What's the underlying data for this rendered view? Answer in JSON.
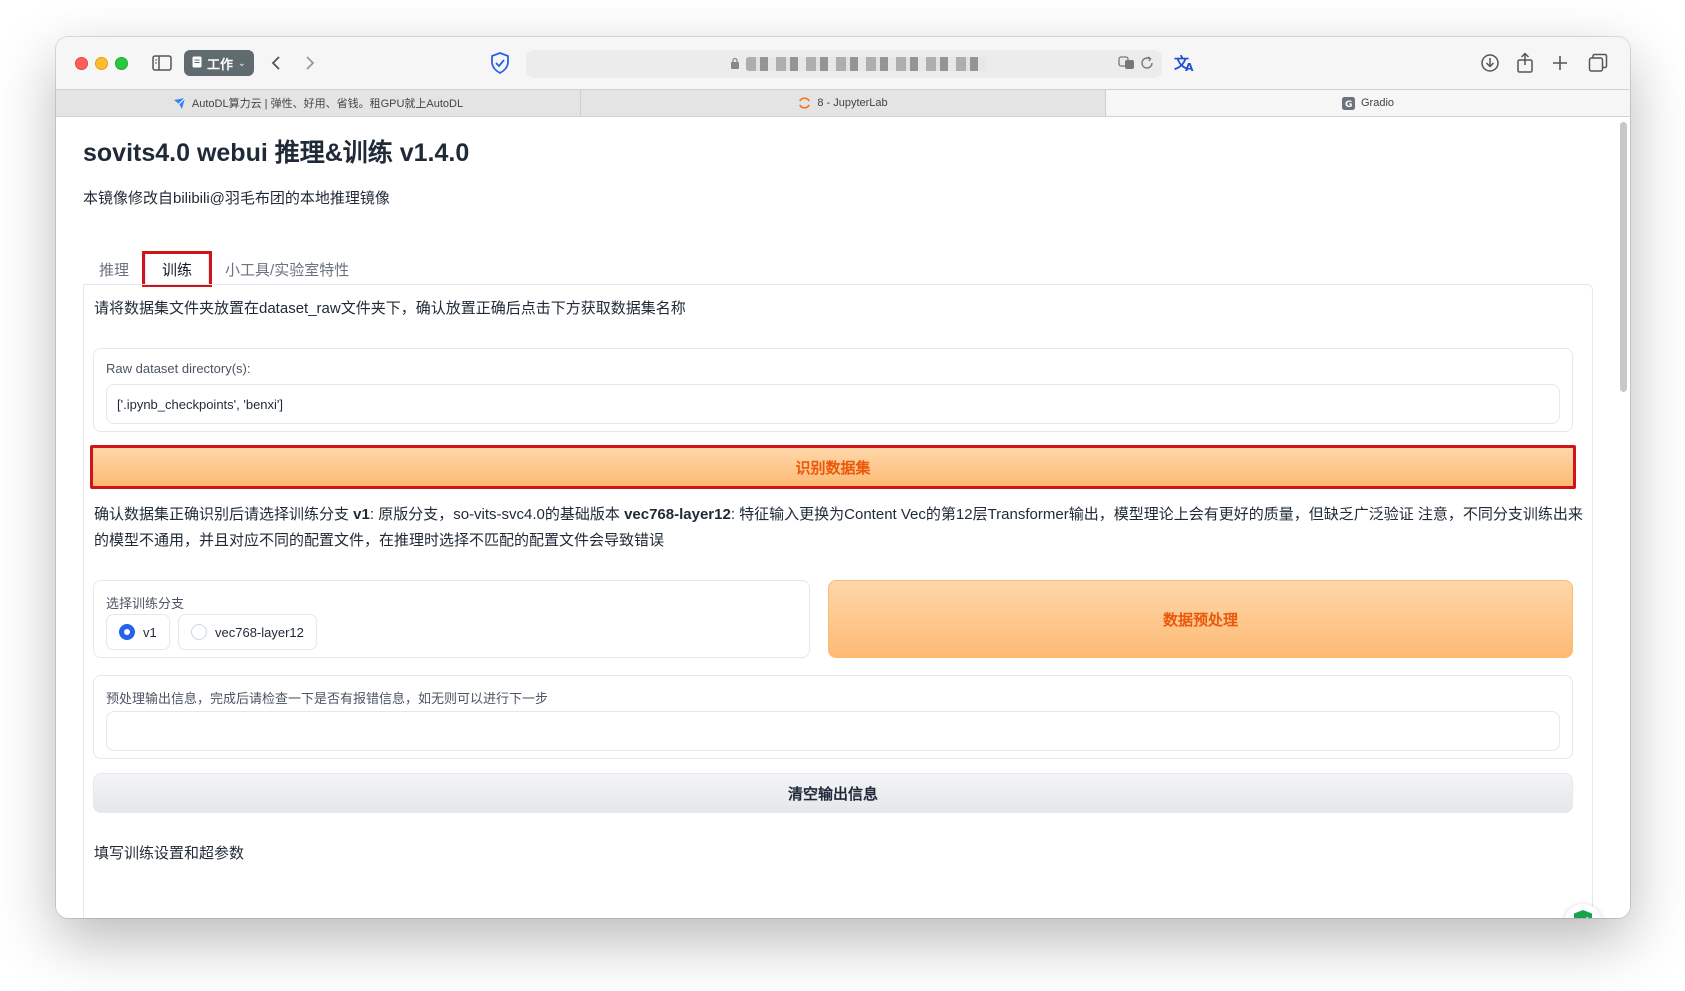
{
  "browser": {
    "workspace_label": "工作",
    "tabs": [
      {
        "label": "AutoDL算力云 | 弹性、好用、省钱。租GPU就上AutoDL",
        "icon": "autodl-icon"
      },
      {
        "label": "8 - JupyterLab",
        "icon": "jupyter-loading-icon"
      },
      {
        "label": "Gradio",
        "icon": "gradio-icon"
      }
    ]
  },
  "page": {
    "title": "sovits4.0 webui 推理&训练 v1.4.0",
    "subtitle": "本镜像修改自bilibili@羽毛布团的本地推理镜像",
    "tabs": [
      "推理",
      "训练",
      "小工具/实验室特性"
    ],
    "selected_tab": "训练"
  },
  "train": {
    "intro": "请将数据集文件夹放置在dataset_raw文件夹下，确认放置正确后点击下方获取数据集名称",
    "raw_dir_label": "Raw dataset directory(s):",
    "raw_dir_value": "['.ipynb_checkpoints', 'benxi']",
    "identify_button": "识别数据集",
    "branch_note_1": "确认数据集正确识别后请选择训练分支 ",
    "branch_note_v1": "v1",
    "branch_note_2": ": 原版分支，so-vits-svc4.0的基础版本 ",
    "branch_note_vec": "vec768-layer12",
    "branch_note_3": ": 特征输入更换为Content Vec的第12层Transformer输出，模型理论上会有更好的质量，但缺乏广泛验证 注意，不同分支训练出来的模型不通用，并且对应不同的配置文件，在推理时选择不匹配的配置文件会导致错误",
    "branch_label": "选择训练分支",
    "branch_options": [
      "v1",
      "vec768-layer12"
    ],
    "branch_selected": "v1",
    "preprocess_button": "数据预处理",
    "output_label": "预处理输出信息，完成后请检查一下是否有报错信息，如无则可以进行下一步",
    "output_value": "",
    "clear_button": "清空输出信息",
    "settings_heading": "填写训练设置和超参数"
  }
}
